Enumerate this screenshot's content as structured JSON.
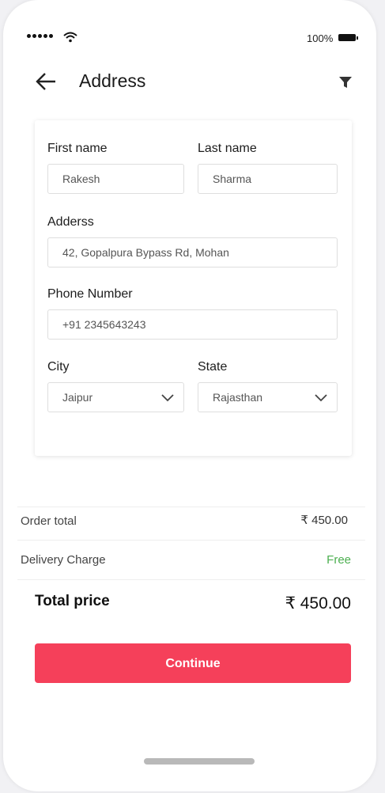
{
  "status_bar": {
    "battery": "100%"
  },
  "header": {
    "title": "Address"
  },
  "form": {
    "first_name_label": "First name",
    "first_name_value": "Rakesh",
    "last_name_label": "Last name",
    "last_name_value": "Sharma",
    "address_label": "Adderss",
    "address_value": "42, Gopalpura Bypass Rd, Mohan",
    "phone_label": "Phone Number",
    "phone_value": "+91 2345643243",
    "city_label": "City",
    "city_value": "Jaipur",
    "state_label": "State",
    "state_value": "Rajasthan"
  },
  "summary": {
    "order_total_label": "Order total",
    "order_total_value": "₹ 450.00",
    "delivery_label": "Delivery Charge",
    "delivery_value": "Free",
    "total_label": "Total price",
    "total_value": "₹ 450.00"
  },
  "continue_label": "Continue",
  "colors": {
    "accent": "#f5405a",
    "free": "#4caf50"
  },
  "icons": [
    "signal-dots-icon",
    "wifi-icon",
    "battery-icon",
    "back-arrow-icon",
    "filter-icon",
    "chevron-down-icon"
  ]
}
